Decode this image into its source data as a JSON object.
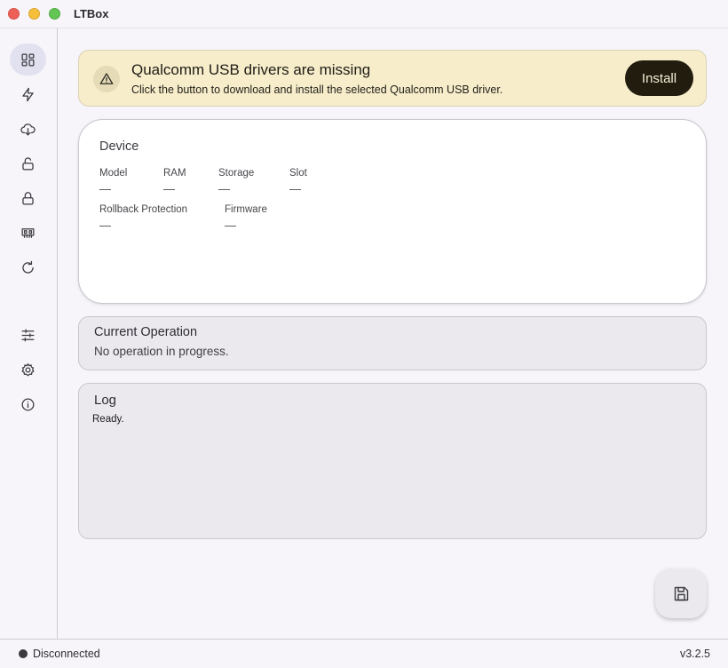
{
  "window": {
    "title": "LTBox"
  },
  "sidebar": {
    "items": [
      {
        "icon": "dashboard-icon",
        "active": true
      },
      {
        "icon": "flash-icon"
      },
      {
        "icon": "cloud-download-icon"
      },
      {
        "icon": "unlock-icon"
      },
      {
        "icon": "lock-icon"
      },
      {
        "icon": "memory-chip-icon"
      },
      {
        "icon": "refresh-icon"
      },
      {
        "icon": "tune-sliders-icon"
      },
      {
        "icon": "settings-gear-icon"
      },
      {
        "icon": "info-icon"
      }
    ]
  },
  "banner": {
    "icon": "warning-icon",
    "title": "Qualcomm USB drivers are missing",
    "description": "Click the button to download and install the selected Qualcomm USB driver.",
    "button_label": "Install",
    "background": "#f7edca",
    "button_color": "#211c0e"
  },
  "device": {
    "title": "Device",
    "fields": {
      "model": {
        "label": "Model",
        "value": "—"
      },
      "ram": {
        "label": "RAM",
        "value": "—"
      },
      "storage": {
        "label": "Storage",
        "value": "—"
      },
      "slot": {
        "label": "Slot",
        "value": "—"
      },
      "rollback": {
        "label": "Rollback Protection",
        "value": "—"
      },
      "firmware": {
        "label": "Firmware",
        "value": "—"
      }
    }
  },
  "operation": {
    "title": "Current Operation",
    "status": "No operation in progress."
  },
  "log": {
    "title": "Log",
    "text": "Ready."
  },
  "fab": {
    "icon": "save-icon"
  },
  "statusbar": {
    "connection": "Disconnected",
    "version": "v3.2.5"
  }
}
